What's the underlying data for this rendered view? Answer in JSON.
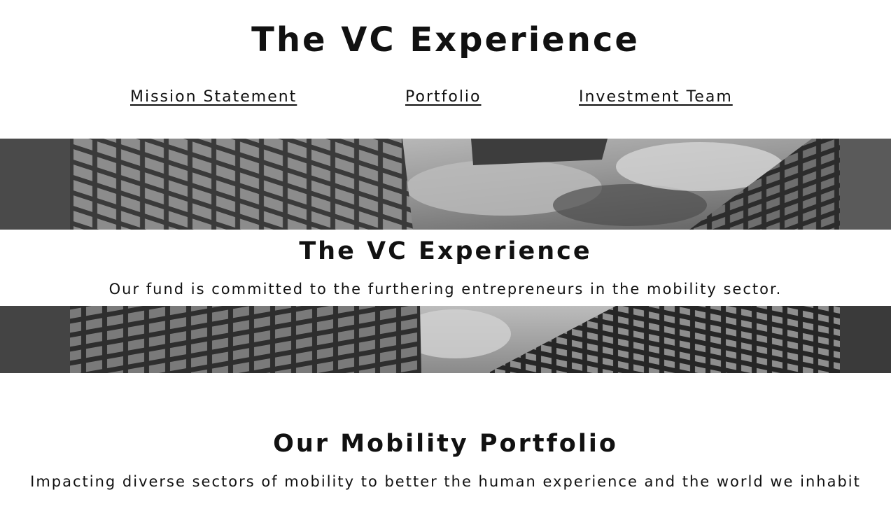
{
  "header": {
    "title": "The VC Experience"
  },
  "nav": {
    "items": [
      {
        "label": "Mission Statement"
      },
      {
        "label": "Portfolio"
      },
      {
        "label": "Investment Team"
      }
    ]
  },
  "hero": {
    "title": "The VC Experience",
    "subtitle": "Our fund is committed to the furthering entrepreneurs in the mobility sector."
  },
  "portfolio": {
    "title": "Our Mobility Portfolio",
    "subtitle": "Impacting diverse sectors of mobility to better the human experience and the world we inhabit"
  },
  "colors": {
    "text": "#111111",
    "background": "#ffffff"
  }
}
